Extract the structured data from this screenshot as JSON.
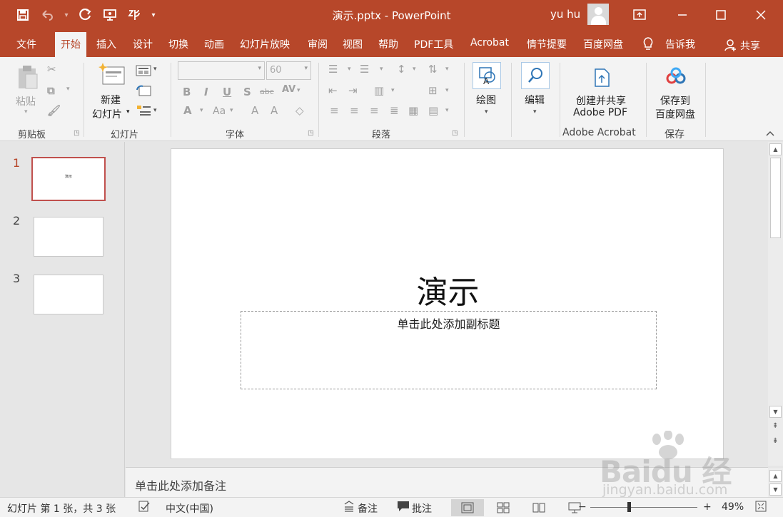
{
  "window": {
    "title": "演示.pptx - PowerPoint",
    "user": "yu hu"
  },
  "qat": {
    "icons": [
      "save-icon",
      "undo-icon",
      "redo-icon",
      "present-icon",
      "touch-icon",
      "customize-icon"
    ]
  },
  "tabs": [
    "文件",
    "开始",
    "插入",
    "设计",
    "切换",
    "动画",
    "幻灯片放映",
    "审阅",
    "视图",
    "帮助",
    "PDF工具",
    "Acrobat",
    "情节提要",
    "百度网盘"
  ],
  "active_tab": "开始",
  "tell_me": "告诉我",
  "share": "共享",
  "ribbon": {
    "clipboard": {
      "label": "剪贴板",
      "paste": "粘贴"
    },
    "slides": {
      "label": "幻灯片",
      "new_slide_line1": "新建",
      "new_slide_line2": "幻灯片"
    },
    "font": {
      "label": "字体",
      "font_size": "60"
    },
    "paragraph": {
      "label": "段落"
    },
    "drawing": {
      "label": "绘图"
    },
    "editing": {
      "label": "编辑"
    },
    "acrobat": {
      "label": "Adobe Acrobat",
      "btn_line1": "创建并共享",
      "btn_line2": "Adobe PDF"
    },
    "save": {
      "label": "保存",
      "btn_line1": "保存到",
      "btn_line2": "百度网盘"
    }
  },
  "slides": [
    {
      "number": "1",
      "mini_title": "演示"
    },
    {
      "number": "2"
    },
    {
      "number": "3"
    }
  ],
  "slide": {
    "title": "演示",
    "subtitle_placeholder": "单击此处添加副标题"
  },
  "notes": {
    "placeholder": "单击此处添加备注"
  },
  "watermark": {
    "logo": "Baidu 经验",
    "url": "jingyan.baidu.com"
  },
  "status": {
    "slide_info": "幻灯片 第 1 张，共 3 张",
    "language": "中文(中国)",
    "notes_btn": "备注",
    "comments_btn": "批注",
    "zoom": "49%"
  },
  "colors": {
    "accent": "#b7472a",
    "ribbon_bg": "#f3f3f3",
    "workspace_bg": "#e6e6e6"
  }
}
